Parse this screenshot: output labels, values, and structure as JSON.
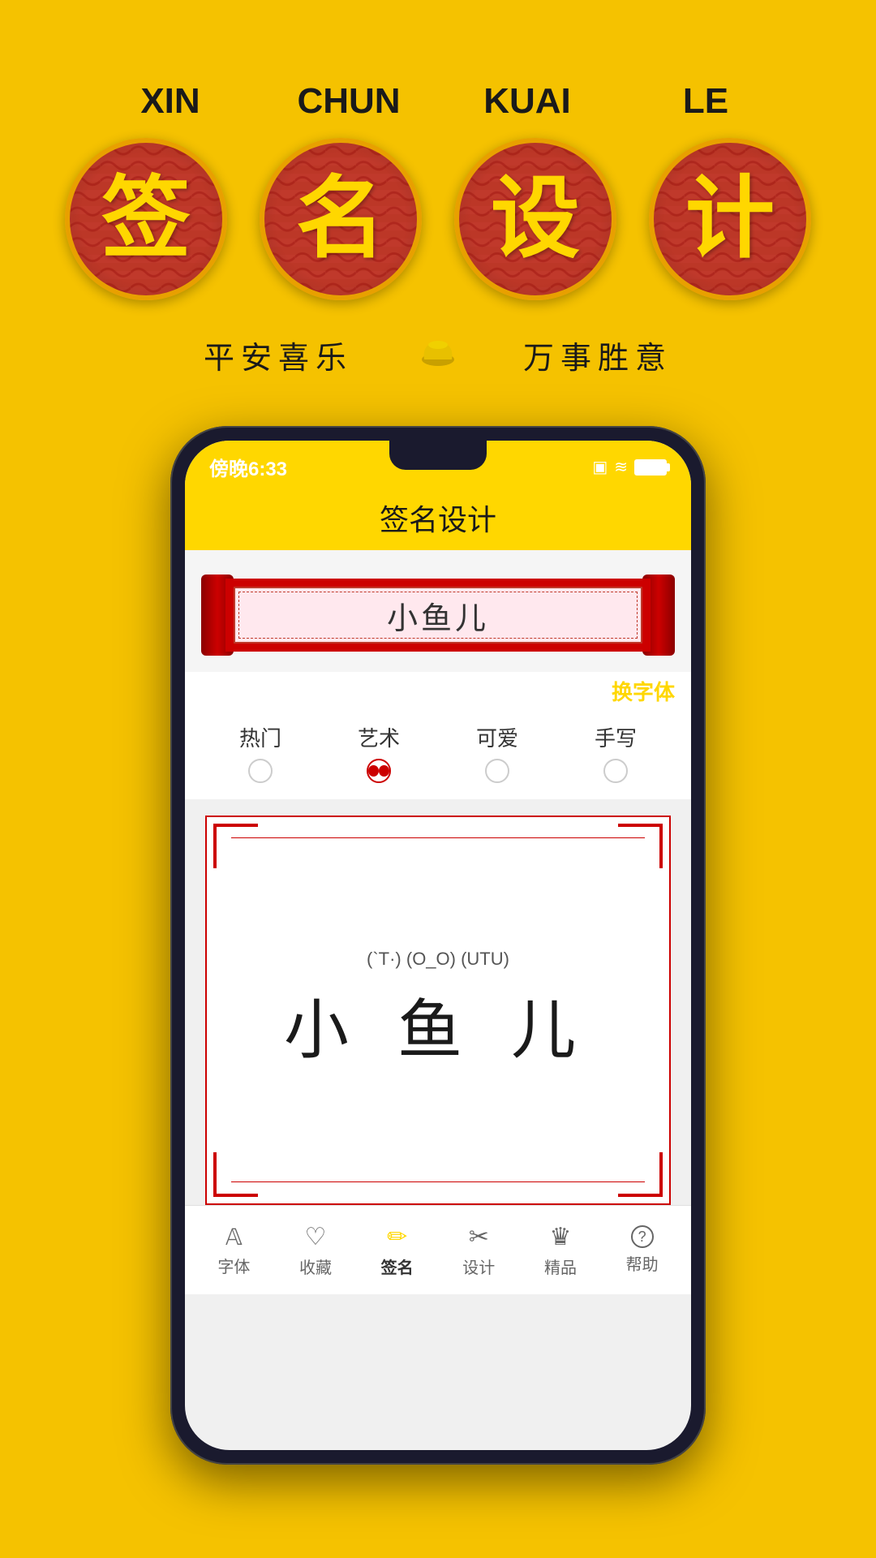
{
  "background_color": "#F5C200",
  "header": {
    "pinyin_labels": [
      "XIN",
      "CHUN",
      "KUAI",
      "LE"
    ],
    "chinese_chars": [
      "签",
      "名",
      "设",
      "计"
    ],
    "subtitle_left": "平安喜乐",
    "subtitle_right": "万事胜意",
    "ingot": "☸"
  },
  "phone": {
    "status_bar": {
      "time": "傍晚6:33",
      "battery": "□",
      "wifi": "WiFi"
    },
    "app_title": "签名设计",
    "scroll_name": "小鱼儿",
    "change_font_label": "换字体",
    "font_tabs": [
      {
        "label": "热门",
        "active": false
      },
      {
        "label": "艺术",
        "active": true
      },
      {
        "label": "可爱",
        "active": false
      },
      {
        "label": "手写",
        "active": false
      }
    ],
    "preview": {
      "emoticons": "(`T·) (O_O) (UTU)",
      "name": "小 鱼 儿"
    },
    "bottom_nav": [
      {
        "label": "字体",
        "icon": "A",
        "active": false
      },
      {
        "label": "收藏",
        "icon": "♡",
        "active": false
      },
      {
        "label": "签名",
        "icon": "✏",
        "active": true
      },
      {
        "label": "设计",
        "icon": "✂",
        "active": false
      },
      {
        "label": "精品",
        "icon": "♛",
        "active": false
      },
      {
        "label": "帮助",
        "icon": "?",
        "active": false
      }
    ]
  }
}
